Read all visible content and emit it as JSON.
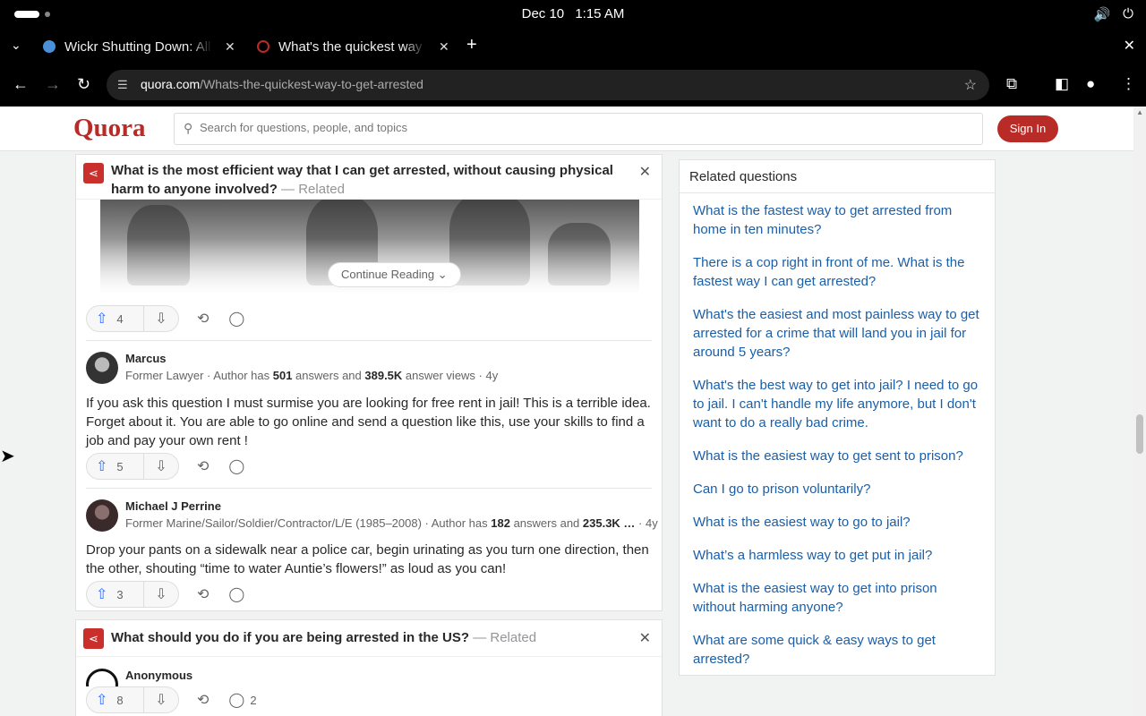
{
  "os": {
    "date": "Dec 10",
    "time": "1:15 AM"
  },
  "browser": {
    "tabs": [
      {
        "title": "Wickr Shutting Down: All",
        "favicon_color": "#4a90d9"
      },
      {
        "title": "What's the quickest way to",
        "favicon_color": "#b92b27"
      }
    ],
    "url_host": "quora.com",
    "url_path": "/Whats-the-quickest-way-to-get-arrested"
  },
  "quora": {
    "logo": "Quora",
    "search_placeholder": "Search for questions, people, and topics",
    "sign_in": "Sign In"
  },
  "related1": {
    "title": "What is the most efficient way that I can get arrested, without causing physical harm to anyone involved?",
    "tag": "— Related",
    "continue_label": "Continue Reading",
    "upvotes": "4"
  },
  "answers": [
    {
      "name": "Marcus",
      "cred_prefix": "Former Lawyer · Author has ",
      "answers_count": "501",
      "cred_mid": " answers and ",
      "views": "389.5K",
      "cred_suffix": " answer views · 4y",
      "body": "If you ask this question I must surmise you are looking for free rent in jail! This is a terrible idea. Forget about it. You are able to go online and send a question like this, use your skills to find a job and pay your own rent !",
      "upvotes": "5"
    },
    {
      "name": "Michael J Perrine",
      "cred_prefix": "Former Marine/Sailor/Soldier/Contractor/L/E (1985–2008) · Author has ",
      "answers_count": "182",
      "cred_mid": " answers and ",
      "views": "235.3K …",
      "cred_suffix": " · 4y",
      "body": "Drop your pants on a sidewalk near a police car, begin urinating as you turn one direction, then the other, shouting “time to water Auntie’s flowers!” as loud as you can!",
      "upvotes": "3"
    }
  ],
  "related2": {
    "title": "What should you do if you are being arrested in the US?",
    "tag": "— Related",
    "author": "Anonymous",
    "upvotes": "8",
    "comments": "2"
  },
  "sidebar": {
    "title": "Related questions",
    "questions": [
      "What is the fastest way to get arrested from home in ten minutes?",
      "There is a cop right in front of me. What is the fastest way I can get arrested?",
      "What's the easiest and most painless way to get arrested for a crime that will land you in jail for around 5 years?",
      "What's the best way to get into jail? I need to go to jail. I can't handle my life anymore, but I don't want to do a really bad crime.",
      "What is the easiest way to get sent to prison?",
      "Can I go to prison voluntarily?",
      "What is the easiest way to go to jail?",
      "What’s a harmless way to get put in jail?",
      "What is the easiest way to get into prison without harming anyone?",
      "What are some quick & easy ways to get arrested?"
    ]
  }
}
